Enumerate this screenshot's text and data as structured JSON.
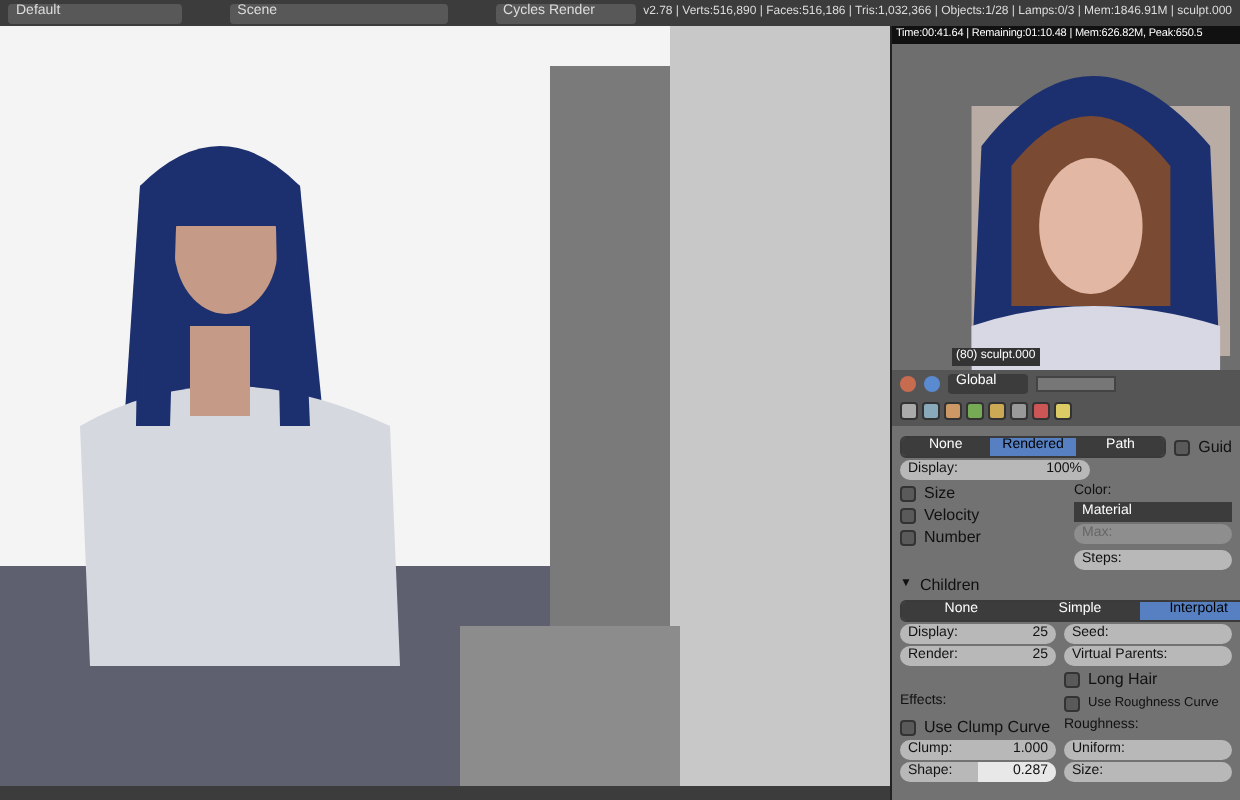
{
  "top_bar": {
    "layout": "Default",
    "scene": "Scene",
    "engine": "Cycles Render",
    "stats": "v2.78 | Verts:516,890 | Faces:516,186 | Tris:1,032,366 | Objects:1/28 | Lamps:0/3 | Mem:1846.91M | sculpt.000"
  },
  "render_preview": {
    "status": "Time:00:41.64 | Remaining:01:10.48 | Mem:626.82M, Peak:650.5",
    "object_label": "(80) sculpt.000"
  },
  "mini_header": {
    "orientation": "Global"
  },
  "properties": {
    "display_tabs": [
      {
        "label": "None",
        "selected": false
      },
      {
        "label": "Rendered",
        "selected": true
      },
      {
        "label": "Path",
        "selected": false
      }
    ],
    "guide": {
      "label": "Guid",
      "checked": false
    },
    "display": {
      "label": "Display:",
      "value": "100%"
    },
    "checks": [
      {
        "label": "Size",
        "checked": false
      },
      {
        "label": "Velocity",
        "checked": false
      },
      {
        "label": "Number",
        "checked": false
      }
    ],
    "color_label": "Color:",
    "color_value": "Material",
    "max": {
      "label": "Max:",
      "disabled": true
    },
    "steps": {
      "label": "Steps:",
      "disabled": false
    },
    "children": {
      "title": "Children",
      "arrow": "▼",
      "expanded": true,
      "tabs": [
        {
          "label": "None",
          "selected": false
        },
        {
          "label": "Simple",
          "selected": false
        },
        {
          "label": "Interpolat",
          "selected": true
        }
      ],
      "display": {
        "label": "Display:",
        "value": "25"
      },
      "render": {
        "label": "Render:",
        "value": "25"
      },
      "seed": {
        "label": "Seed:"
      },
      "virtual_parents": {
        "label": "Virtual Parents:"
      },
      "long_hair": {
        "label": "Long Hair",
        "checked": false
      },
      "effects_label": "Effects:",
      "use_roughness_curve": {
        "label": "Use Roughness Curve",
        "checked": false
      },
      "use_clump_curve": {
        "label": "Use Clump Curve",
        "checked": false
      },
      "roughness_label": "Roughness:",
      "clump": {
        "label": "Clump:",
        "value": "1.000"
      },
      "uniform": {
        "label": "Uniform:"
      },
      "shape": {
        "label": "Shape:",
        "value": "0.287",
        "level": 0.5
      },
      "size": {
        "label": "Size:"
      }
    }
  }
}
